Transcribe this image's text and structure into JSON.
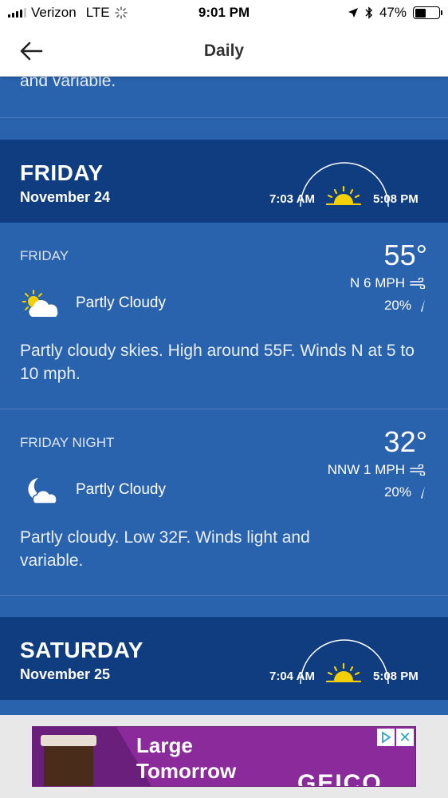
{
  "status_bar": {
    "carrier": "Verizon",
    "network": "LTE",
    "time": "9:01 PM",
    "battery": "47%",
    "battery_level": 0.47
  },
  "header": {
    "title": "Daily",
    "back_icon": "arrow-left-icon"
  },
  "top_fragment": "and variable.",
  "days": [
    {
      "name": "FRIDAY",
      "date": "November 24",
      "sunrise": "7:03 AM",
      "sunset": "5:08 PM",
      "periods": [
        {
          "name": "FRIDAY",
          "temp": "55°",
          "wind": "N 6 MPH",
          "precip": "20%",
          "condition": "Partly Cloudy",
          "icon": "partly-cloudy-day-icon",
          "description": "Partly cloudy skies. High around 55F. Winds N at 5 to 10 mph."
        },
        {
          "name": "FRIDAY NIGHT",
          "temp": "32°",
          "wind": "NNW 1 MPH",
          "precip": "20%",
          "condition": "Partly Cloudy",
          "icon": "partly-cloudy-night-icon",
          "description": "Partly cloudy. Low 32F. Winds light and variable."
        }
      ]
    },
    {
      "name": "SATURDAY",
      "date": "November 25",
      "sunrise": "7:04 AM",
      "sunset": "5:08 PM"
    }
  ],
  "ad": {
    "line1": "Large",
    "line2": "Tomorrow",
    "brand": "GEICO",
    "close": "✕"
  },
  "colors": {
    "panel": "#2a63ad",
    "day_header": "#0f3d80",
    "sun": "#f5d000"
  }
}
